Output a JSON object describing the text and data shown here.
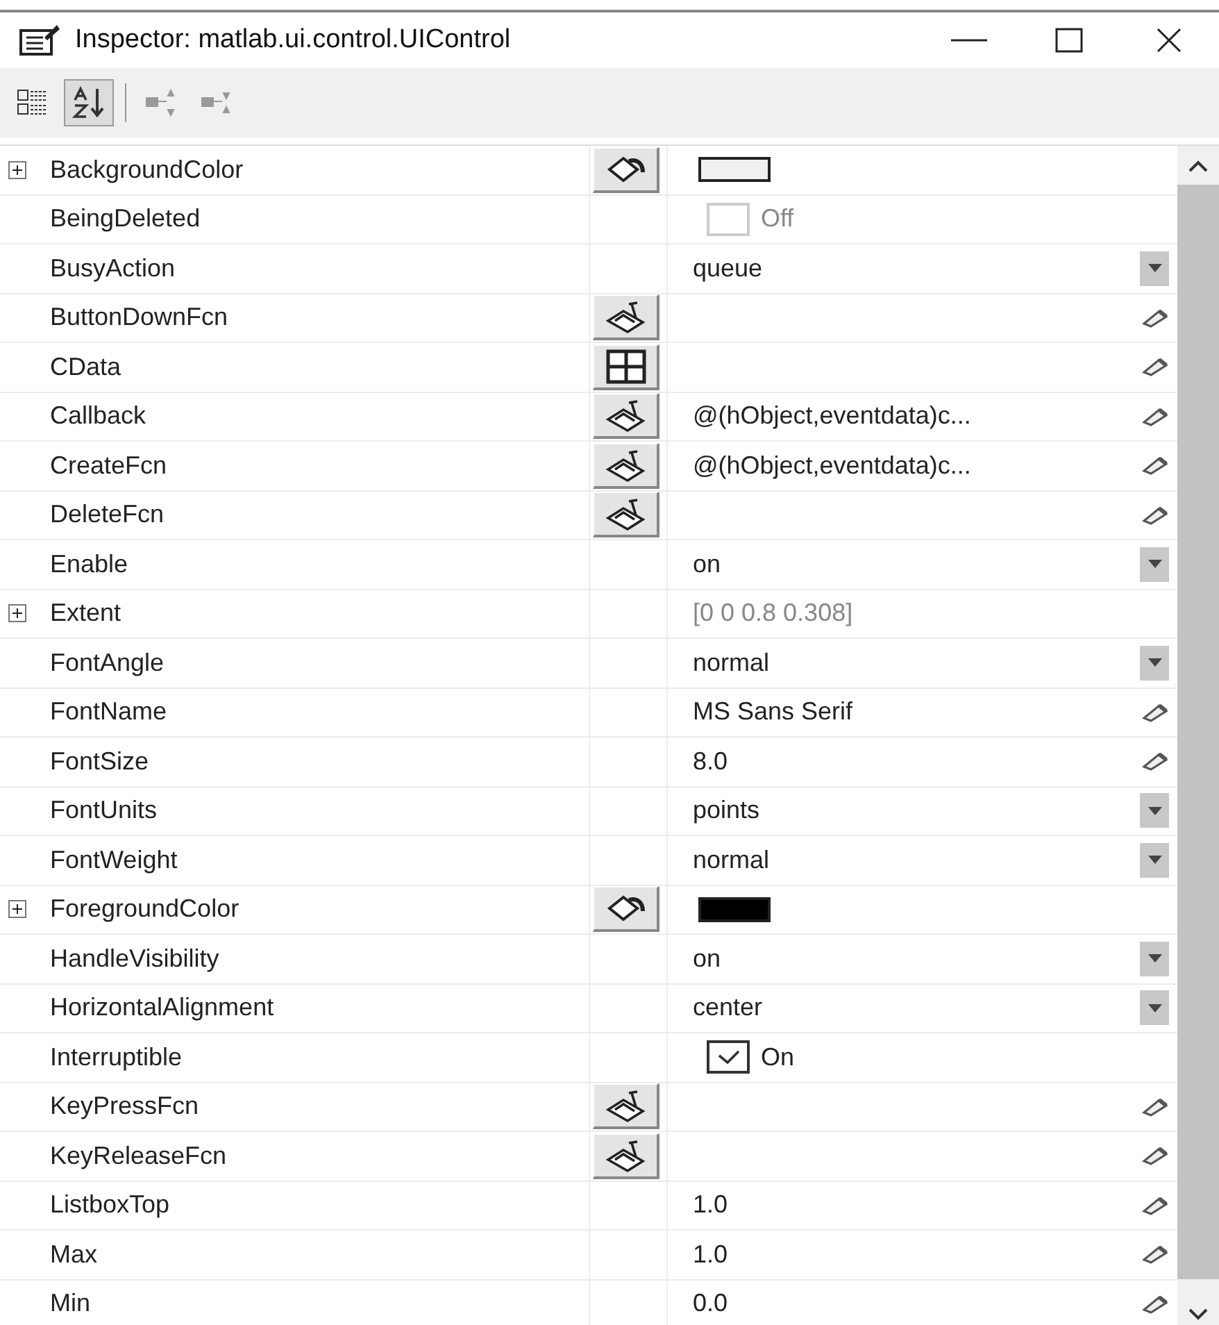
{
  "window": {
    "title": "Inspector:  matlab.ui.control.UIControl",
    "controls": [
      {
        "kind": "minimize"
      },
      {
        "kind": "maximize"
      },
      {
        "kind": "close"
      }
    ]
  },
  "toolbar": [
    {
      "kind": "categorized",
      "selected": false,
      "disabled": false
    },
    {
      "kind": "alphabetical",
      "selected": true,
      "disabled": false
    },
    {
      "kind": "expand-all",
      "selected": false,
      "disabled": true
    },
    {
      "kind": "collapse-all",
      "selected": false,
      "disabled": true
    }
  ],
  "rows": [
    {
      "name": "BackgroundColor",
      "expanded": false,
      "editor_button": {
        "kind": "color"
      },
      "kind": "swatch",
      "color": "#f0f0f0"
    },
    {
      "name": "BeingDeleted",
      "kind": "checkbox",
      "value": "Off",
      "checked": false,
      "disabled": true
    },
    {
      "name": "BusyAction",
      "kind": "dropdown",
      "value": "queue"
    },
    {
      "name": "ButtonDownFcn",
      "editor_button": {
        "kind": "function"
      },
      "kind": "edit"
    },
    {
      "name": "CData",
      "editor_button": {
        "kind": "matrix"
      },
      "kind": "edit"
    },
    {
      "name": "Callback",
      "editor_button": {
        "kind": "function"
      },
      "kind": "edit",
      "value": "@(hObject,eventdata)c..."
    },
    {
      "name": "CreateFcn",
      "editor_button": {
        "kind": "function"
      },
      "kind": "edit",
      "value": "@(hObject,eventdata)c..."
    },
    {
      "name": "DeleteFcn",
      "editor_button": {
        "kind": "function"
      },
      "kind": "edit"
    },
    {
      "name": "Enable",
      "kind": "dropdown",
      "value": "on"
    },
    {
      "name": "Extent",
      "expanded": false,
      "kind": "readonly",
      "value": "[0 0 0.8 0.308]"
    },
    {
      "name": "FontAngle",
      "kind": "dropdown",
      "value": "normal"
    },
    {
      "name": "FontName",
      "kind": "edit",
      "value": "MS Sans Serif"
    },
    {
      "name": "FontSize",
      "kind": "edit",
      "value": "8.0"
    },
    {
      "name": "FontUnits",
      "kind": "dropdown",
      "value": "points"
    },
    {
      "name": "FontWeight",
      "kind": "dropdown",
      "value": "normal"
    },
    {
      "name": "ForegroundColor",
      "expanded": false,
      "editor_button": {
        "kind": "color"
      },
      "kind": "swatch",
      "color": "#000000"
    },
    {
      "name": "HandleVisibility",
      "kind": "dropdown",
      "value": "on"
    },
    {
      "name": "HorizontalAlignment",
      "kind": "dropdown",
      "value": "center"
    },
    {
      "name": "Interruptible",
      "kind": "checkbox",
      "value": "On",
      "checked": true,
      "disabled": false
    },
    {
      "name": "KeyPressFcn",
      "editor_button": {
        "kind": "function"
      },
      "kind": "edit"
    },
    {
      "name": "KeyReleaseFcn",
      "editor_button": {
        "kind": "function"
      },
      "kind": "edit"
    },
    {
      "name": "ListboxTop",
      "kind": "edit",
      "value": "1.0"
    },
    {
      "name": "Max",
      "kind": "edit",
      "value": "1.0"
    },
    {
      "name": "Min",
      "kind": "edit",
      "value": "0.0"
    }
  ]
}
